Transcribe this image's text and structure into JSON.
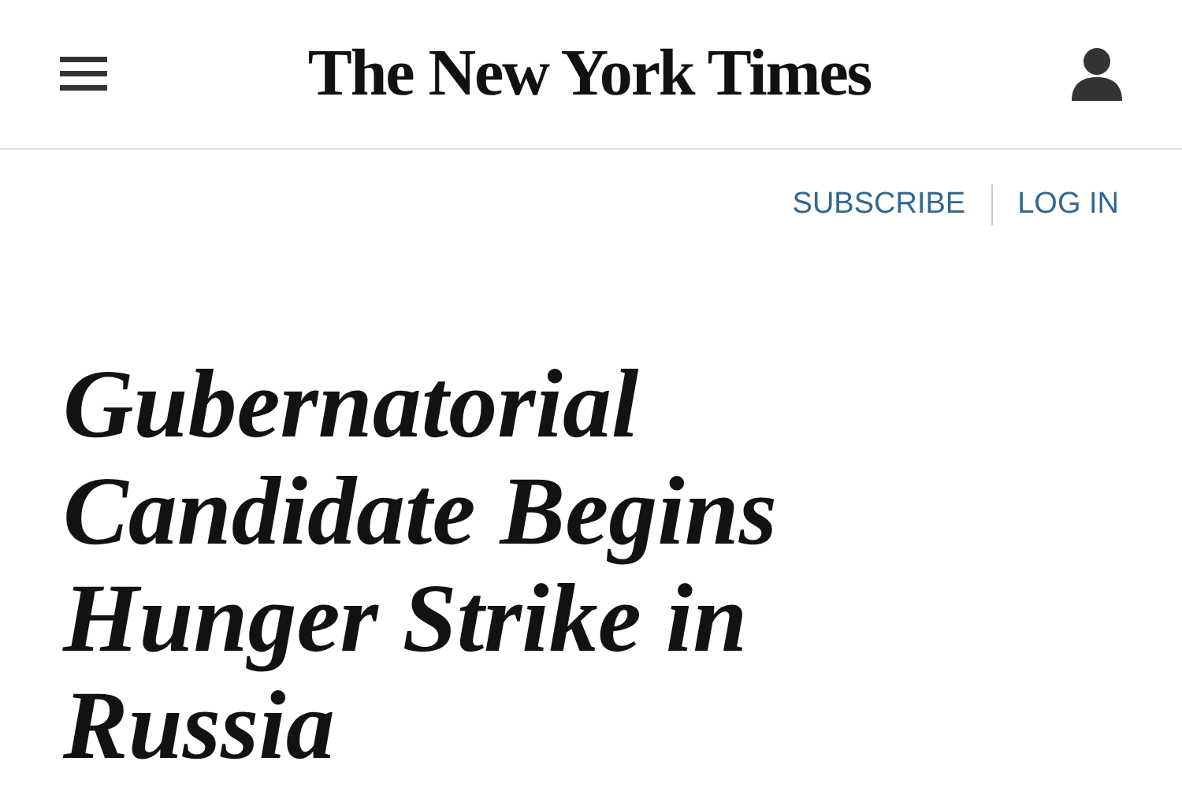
{
  "header": {
    "logo": "The New York Times"
  },
  "account_links": [
    {
      "label": "SUBSCRIBE"
    },
    {
      "label": "LOG IN"
    }
  ],
  "article": {
    "headline": "Gubernatorial Candidate Begins Hunger Strike in Russia"
  }
}
